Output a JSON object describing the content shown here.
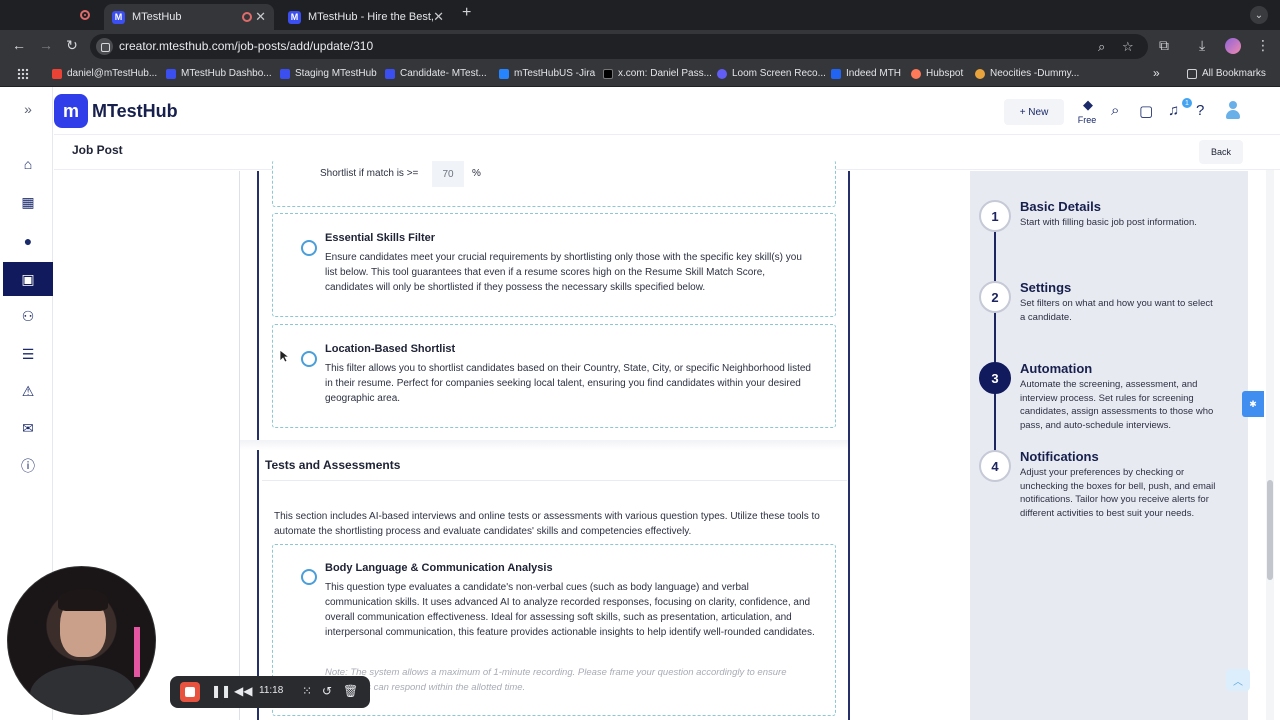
{
  "browser": {
    "tabs": [
      {
        "label": "MTestHub",
        "favicon": "M",
        "active": true
      },
      {
        "label": "MTestHub - Hire the Best, By",
        "favicon": "M",
        "active": false
      }
    ],
    "url": "creator.mtesthub.com/job-posts/add/update/310",
    "bookmarks": [
      {
        "label": "daniel@mTestHub...",
        "icon": "gmail-icon",
        "color": "#ea4335"
      },
      {
        "label": "MTestHub Dashbo...",
        "icon": "mtesthub-icon",
        "color": "#3b4ef0"
      },
      {
        "label": "Staging MTestHub",
        "icon": "mtesthub-icon",
        "color": "#3b4ef0"
      },
      {
        "label": "Candidate- MTest...",
        "icon": "mtesthub-icon",
        "color": "#3b4ef0"
      },
      {
        "label": "mTestHubUS -Jira",
        "icon": "jira-icon",
        "color": "#2684ff"
      },
      {
        "label": "x.com: Daniel Pass...",
        "icon": "x-icon",
        "color": "#000000"
      },
      {
        "label": "Loom Screen Reco...",
        "icon": "loom-icon",
        "color": "#625df5"
      },
      {
        "label": "Indeed MTH",
        "icon": "indeed-icon",
        "color": "#2164f3"
      },
      {
        "label": "Hubspot",
        "icon": "hubspot-icon",
        "color": "#ff7a59"
      },
      {
        "label": "Neocities -Dummy...",
        "icon": "neocities-icon",
        "color": "#e8a33d"
      }
    ],
    "all_bookmarks": "All Bookmarks"
  },
  "app": {
    "logo_text": "MTestHub",
    "logo_mark": "m",
    "new_label": "+ New",
    "plan_label": "Free",
    "notification_count": "1",
    "page_title": "Job Post",
    "back_label": "Back"
  },
  "form": {
    "shortlist_label": "Shortlist if match is >=",
    "shortlist_value": "70",
    "shortlist_unit": "%",
    "filters": [
      {
        "title": "Essential Skills Filter",
        "description": "Ensure candidates meet your crucial requirements by shortlisting only those with the specific key skill(s) you list below. This tool guarantees that even if a resume scores high on the Resume Skill Match Score, candidates will only be shortlisted if they possess the necessary skills specified below."
      },
      {
        "title": "Location-Based Shortlist",
        "description": "This filter allows you to shortlist candidates based on their Country, State, City, or specific Neighborhood listed in their resume. Perfect for companies seeking local talent, ensuring you find candidates within your desired geographic area."
      }
    ],
    "tests_section_title": "Tests and Assessments",
    "tests_section_desc": "This section includes AI-based interviews and online tests or assessments with various question types. Utilize these tools to automate the shortlisting process and evaluate candidates' skills and competencies effectively.",
    "assessments": [
      {
        "title": "Body Language & Communication Analysis",
        "description": "This question type evaluates a candidate's non-verbal cues (such as body language) and verbal communication skills. It uses advanced AI to analyze recorded responses, focusing on clarity, confidence, and overall communication effectiveness. Ideal for assessing soft skills, such as presentation, articulation, and interpersonal communication, this feature provides actionable insights to help identify well-rounded candidates.",
        "note": "Note: The system allows a maximum of 1-minute recording. Please frame your question accordingly to ensure candidates can respond within the allotted time."
      }
    ]
  },
  "steps": [
    {
      "num": "1",
      "title": "Basic Details",
      "desc": "Start with filling basic job post information.",
      "active": false
    },
    {
      "num": "2",
      "title": "Settings",
      "desc": "Set filters on what and how you want to select a candidate.",
      "active": false
    },
    {
      "num": "3",
      "title": "Automation",
      "desc": "Automate the screening, assessment, and interview process. Set rules for screening candidates, assign assessments to those who pass, and auto-schedule interviews.",
      "active": true
    },
    {
      "num": "4",
      "title": "Notifications",
      "desc": "Adjust your preferences by checking or unchecking the boxes for bell, push, and email notifications. Tailor how you receive alerts for different activities to best suit your needs.",
      "active": false
    }
  ],
  "recorder": {
    "time": "11:18"
  }
}
